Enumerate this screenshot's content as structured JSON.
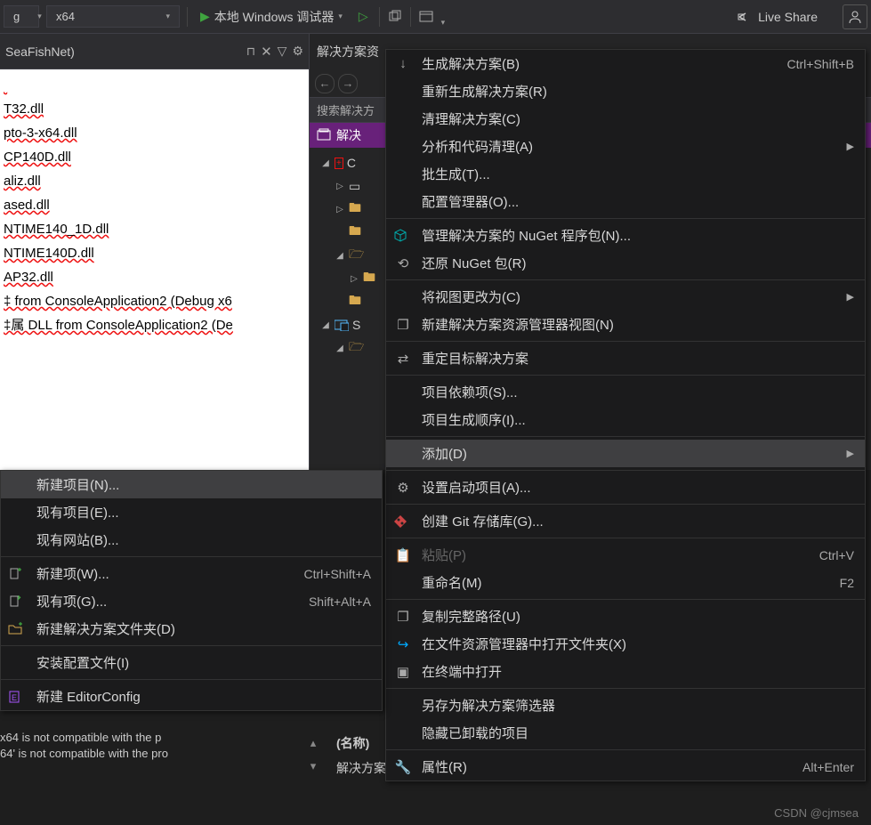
{
  "toolbar": {
    "config_tail": "g",
    "platform": "x64",
    "debugger": "本地 Windows 调试器",
    "liveshare": "Live Share"
  },
  "left_panel": {
    "tab_title": "SeaFishNet)",
    "lines": [
      "",
      "T32.dll",
      "pto-3-x64.dll",
      "CP140D.dll",
      "aliz.dll",
      "ased.dll",
      "NTIME140_1D.dll",
      "NTIME140D.dll",
      "AP32.dll",
      "‡ from ConsoleApplication2 (Debug x6",
      "‡属 DLL from ConsoleApplication2 (De"
    ]
  },
  "solution": {
    "tab": "解决方案资",
    "search": "搜索解决方",
    "root": "解决",
    "row_c": "C",
    "row_s": "S"
  },
  "main_menu": [
    {
      "icon": "↓",
      "label": "生成解决方案(B)",
      "shortcut": "Ctrl+Shift+B",
      "type": "item"
    },
    {
      "label": "重新生成解决方案(R)",
      "type": "item"
    },
    {
      "label": "清理解决方案(C)",
      "type": "item"
    },
    {
      "label": "分析和代码清理(A)",
      "sub": true,
      "type": "item"
    },
    {
      "label": "批生成(T)...",
      "type": "item"
    },
    {
      "label": "配置管理器(O)...",
      "type": "item"
    },
    {
      "type": "sep"
    },
    {
      "icon": "pkg",
      "iconColor": "#0aa",
      "label": "管理解决方案的 NuGet 程序包(N)...",
      "type": "item"
    },
    {
      "icon": "⟲",
      "label": "还原 NuGet 包(R)",
      "type": "item"
    },
    {
      "type": "sep"
    },
    {
      "label": "将视图更改为(C)",
      "sub": true,
      "type": "item"
    },
    {
      "icon": "❐",
      "label": "新建解决方案资源管理器视图(N)",
      "type": "item"
    },
    {
      "type": "sep"
    },
    {
      "icon": "⇄",
      "label": "重定目标解决方案",
      "type": "item"
    },
    {
      "type": "sep"
    },
    {
      "label": "项目依赖项(S)...",
      "type": "item"
    },
    {
      "label": "项目生成顺序(I)...",
      "type": "item"
    },
    {
      "type": "sep"
    },
    {
      "label": "添加(D)",
      "sub": true,
      "type": "item",
      "hl": true
    },
    {
      "type": "sep"
    },
    {
      "icon": "⚙",
      "label": "设置启动项目(A)...",
      "type": "item"
    },
    {
      "type": "sep"
    },
    {
      "icon": "git",
      "iconColor": "#c44",
      "label": "创建 Git 存储库(G)...",
      "type": "item"
    },
    {
      "type": "sep"
    },
    {
      "icon": "📋",
      "label": "粘贴(P)",
      "shortcut": "Ctrl+V",
      "disabled": true,
      "type": "item"
    },
    {
      "label": "重命名(M)",
      "shortcut": "F2",
      "type": "item"
    },
    {
      "type": "sep"
    },
    {
      "icon": "❐",
      "label": "复制完整路径(U)",
      "type": "item"
    },
    {
      "icon": "↪",
      "iconColor": "#0af",
      "label": "在文件资源管理器中打开文件夹(X)",
      "type": "item"
    },
    {
      "icon": "▣",
      "label": "在终端中打开",
      "type": "item"
    },
    {
      "type": "sep"
    },
    {
      "label": "另存为解决方案筛选器",
      "type": "item"
    },
    {
      "label": "隐藏已卸载的项目",
      "type": "item"
    },
    {
      "type": "sep"
    },
    {
      "icon": "🔧",
      "label": "属性(R)",
      "shortcut": "Alt+Enter",
      "type": "item"
    }
  ],
  "sub_menu": [
    {
      "label": "新建项目(N)...",
      "type": "item",
      "hl": true
    },
    {
      "label": "现有项目(E)...",
      "type": "item"
    },
    {
      "label": "现有网站(B)...",
      "type": "item"
    },
    {
      "type": "sep"
    },
    {
      "icon": "newfile",
      "label": "新建项(W)...",
      "shortcut": "Ctrl+Shift+A",
      "type": "item"
    },
    {
      "icon": "addfile",
      "label": "现有项(G)...",
      "shortcut": "Shift+Alt+A",
      "type": "item"
    },
    {
      "icon": "newfolder",
      "label": "新建解决方案文件夹(D)",
      "type": "item"
    },
    {
      "type": "sep"
    },
    {
      "label": "安装配置文件(I)",
      "type": "item"
    },
    {
      "type": "sep"
    },
    {
      "icon": "editorconfig",
      "iconColor": "#a5f",
      "label": "新建 EditorConfig",
      "type": "item"
    }
  ],
  "output": [
    " x64  is not compatible with the p",
    "64' is not compatible with the pro"
  ],
  "properties": {
    "name_label": "(名称)",
    "path_label": "解决方案文"
  },
  "watermark": "CSDN @cjmsea"
}
